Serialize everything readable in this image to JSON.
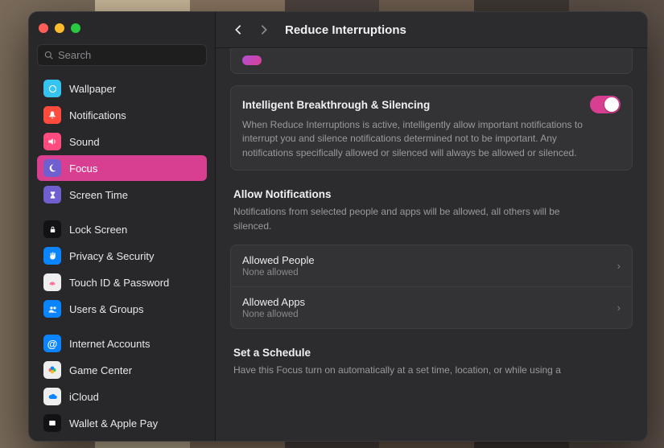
{
  "window": {
    "title": "Reduce Interruptions"
  },
  "search": {
    "placeholder": "Search"
  },
  "sidebar": {
    "items": [
      {
        "label": "Wallpaper",
        "icon": "wallpaper",
        "bg": "#35c3ef"
      },
      {
        "label": "Notifications",
        "icon": "bell",
        "bg": "#ff4b3e"
      },
      {
        "label": "Sound",
        "icon": "speaker",
        "bg": "#ff4b7d"
      },
      {
        "label": "Focus",
        "icon": "moon",
        "bg": "#6f5fcf",
        "selected": true
      },
      {
        "label": "Screen Time",
        "icon": "hourglass",
        "bg": "#6f5fcf"
      },
      {
        "label": "Lock Screen",
        "icon": "lock",
        "bg": "#121214"
      },
      {
        "label": "Privacy & Security",
        "icon": "hand",
        "bg": "#0a84ff"
      },
      {
        "label": "Touch ID & Password",
        "icon": "finger",
        "bg": "#eeeeee"
      },
      {
        "label": "Users & Groups",
        "icon": "users",
        "bg": "#0a84ff"
      },
      {
        "label": "Internet Accounts",
        "icon": "at",
        "bg": "#0a84ff"
      },
      {
        "label": "Game Center",
        "icon": "game",
        "bg": "#eeeeee"
      },
      {
        "label": "iCloud",
        "icon": "cloud",
        "bg": "#eeeeee"
      },
      {
        "label": "Wallet & Apple Pay",
        "icon": "wallet",
        "bg": "#121214"
      }
    ]
  },
  "intelligent": {
    "heading": "Intelligent Breakthrough & Silencing",
    "body": "When Reduce Interruptions is active, intelligently allow important notifications to interrupt you and silence notifications determined not to be important. Any notifications specifically allowed or silenced will always be allowed or silenced.",
    "toggle_on": true
  },
  "allow": {
    "heading": "Allow Notifications",
    "body": "Notifications from selected people and apps will be allowed, all others will be silenced.",
    "rows": [
      {
        "label": "Allowed People",
        "sub": "None allowed"
      },
      {
        "label": "Allowed Apps",
        "sub": "None allowed"
      }
    ]
  },
  "schedule": {
    "heading": "Set a Schedule",
    "body": "Have this Focus turn on automatically at a set time, location, or while using a"
  }
}
